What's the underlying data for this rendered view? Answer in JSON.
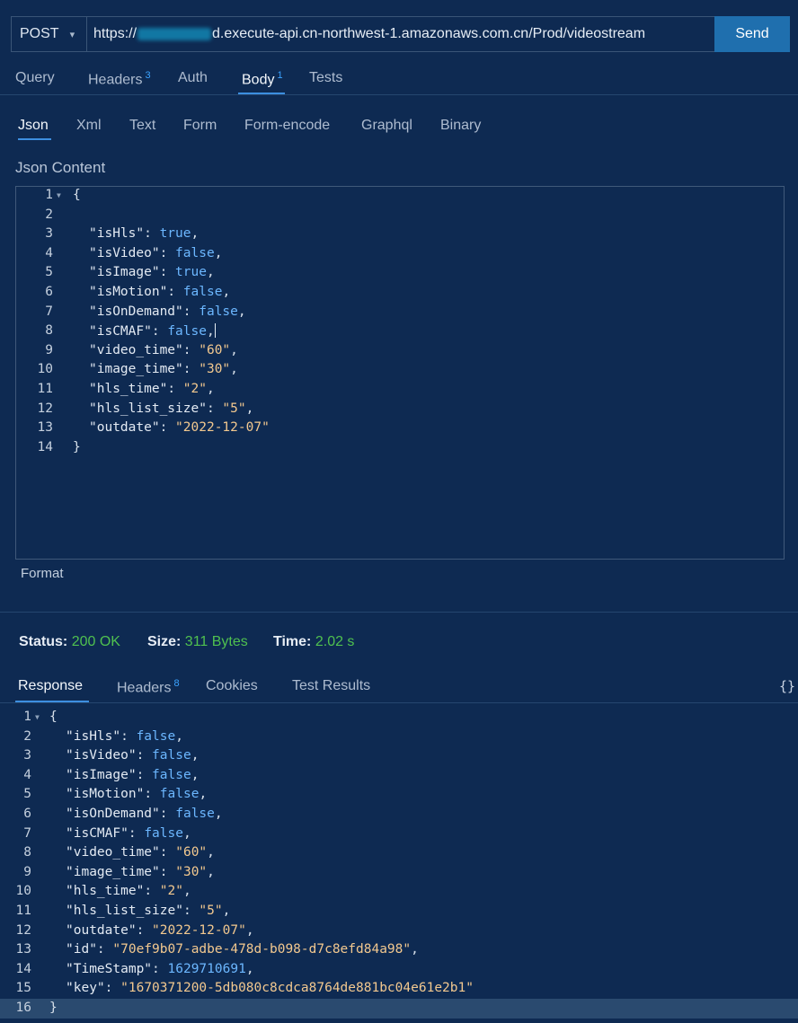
{
  "request": {
    "method": "POST",
    "url_prefix": "https://",
    "url_suffix": "d.execute-api.cn-northwest-1.amazonaws.com.cn/Prod/videostream",
    "send_label": "Send"
  },
  "tabs": [
    {
      "label": "Query",
      "badge": ""
    },
    {
      "label": "Headers",
      "badge": "3"
    },
    {
      "label": "Auth",
      "badge": ""
    },
    {
      "label": "Body",
      "badge": "1"
    },
    {
      "label": "Tests",
      "badge": ""
    }
  ],
  "body_tabs": [
    "Json",
    "Xml",
    "Text",
    "Form",
    "Form-encode",
    "Graphql",
    "Binary"
  ],
  "json_content_label": "Json Content",
  "request_lines": [
    [
      {
        "t": "p",
        "v": "{"
      }
    ],
    [],
    [
      {
        "t": "k",
        "v": "\"isHls\""
      },
      {
        "t": "p",
        "v": ": "
      },
      {
        "t": "b",
        "v": "true"
      },
      {
        "t": "p",
        "v": ","
      }
    ],
    [
      {
        "t": "k",
        "v": "\"isVideo\""
      },
      {
        "t": "p",
        "v": ": "
      },
      {
        "t": "b",
        "v": "false"
      },
      {
        "t": "p",
        "v": ","
      }
    ],
    [
      {
        "t": "k",
        "v": "\"isImage\""
      },
      {
        "t": "p",
        "v": ": "
      },
      {
        "t": "b",
        "v": "true"
      },
      {
        "t": "p",
        "v": ","
      }
    ],
    [
      {
        "t": "k",
        "v": "\"isMotion\""
      },
      {
        "t": "p",
        "v": ": "
      },
      {
        "t": "b",
        "v": "false"
      },
      {
        "t": "p",
        "v": ","
      }
    ],
    [
      {
        "t": "k",
        "v": "\"isOnDemand\""
      },
      {
        "t": "p",
        "v": ": "
      },
      {
        "t": "b",
        "v": "false"
      },
      {
        "t": "p",
        "v": ","
      }
    ],
    [
      {
        "t": "k",
        "v": "\"isCMAF\""
      },
      {
        "t": "p",
        "v": ": "
      },
      {
        "t": "b",
        "v": "false"
      },
      {
        "t": "p",
        "v": ","
      }
    ],
    [
      {
        "t": "k",
        "v": "\"video_time\""
      },
      {
        "t": "p",
        "v": ": "
      },
      {
        "t": "s",
        "v": "\"60\""
      },
      {
        "t": "p",
        "v": ","
      }
    ],
    [
      {
        "t": "k",
        "v": "\"image_time\""
      },
      {
        "t": "p",
        "v": ": "
      },
      {
        "t": "s",
        "v": "\"30\""
      },
      {
        "t": "p",
        "v": ","
      }
    ],
    [
      {
        "t": "k",
        "v": "\"hls_time\""
      },
      {
        "t": "p",
        "v": ": "
      },
      {
        "t": "s",
        "v": "\"2\""
      },
      {
        "t": "p",
        "v": ","
      }
    ],
    [
      {
        "t": "k",
        "v": "\"hls_list_size\""
      },
      {
        "t": "p",
        "v": ": "
      },
      {
        "t": "s",
        "v": "\"5\""
      },
      {
        "t": "p",
        "v": ","
      }
    ],
    [
      {
        "t": "k",
        "v": "\"outdate\""
      },
      {
        "t": "p",
        "v": ": "
      },
      {
        "t": "s",
        "v": "\"2022-12-07\""
      }
    ],
    [
      {
        "t": "p",
        "v": "}"
      }
    ]
  ],
  "format_label": "Format",
  "status": {
    "status_label": "Status:",
    "status_value": "200 OK",
    "size_label": "Size:",
    "size_value": "311 Bytes",
    "time_label": "Time:",
    "time_value": "2.02 s"
  },
  "response_tabs": [
    {
      "label": "Response",
      "badge": ""
    },
    {
      "label": "Headers",
      "badge": "8"
    },
    {
      "label": "Cookies",
      "badge": ""
    },
    {
      "label": "Test Results",
      "badge": ""
    }
  ],
  "braces_icon_label": "{}",
  "response_lines": [
    [
      {
        "t": "p",
        "v": "{"
      }
    ],
    [
      {
        "t": "k",
        "v": "\"isHls\""
      },
      {
        "t": "p",
        "v": ": "
      },
      {
        "t": "b",
        "v": "false"
      },
      {
        "t": "p",
        "v": ","
      }
    ],
    [
      {
        "t": "k",
        "v": "\"isVideo\""
      },
      {
        "t": "p",
        "v": ": "
      },
      {
        "t": "b",
        "v": "false"
      },
      {
        "t": "p",
        "v": ","
      }
    ],
    [
      {
        "t": "k",
        "v": "\"isImage\""
      },
      {
        "t": "p",
        "v": ": "
      },
      {
        "t": "b",
        "v": "false"
      },
      {
        "t": "p",
        "v": ","
      }
    ],
    [
      {
        "t": "k",
        "v": "\"isMotion\""
      },
      {
        "t": "p",
        "v": ": "
      },
      {
        "t": "b",
        "v": "false"
      },
      {
        "t": "p",
        "v": ","
      }
    ],
    [
      {
        "t": "k",
        "v": "\"isOnDemand\""
      },
      {
        "t": "p",
        "v": ": "
      },
      {
        "t": "b",
        "v": "false"
      },
      {
        "t": "p",
        "v": ","
      }
    ],
    [
      {
        "t": "k",
        "v": "\"isCMAF\""
      },
      {
        "t": "p",
        "v": ": "
      },
      {
        "t": "b",
        "v": "false"
      },
      {
        "t": "p",
        "v": ","
      }
    ],
    [
      {
        "t": "k",
        "v": "\"video_time\""
      },
      {
        "t": "p",
        "v": ": "
      },
      {
        "t": "s",
        "v": "\"60\""
      },
      {
        "t": "p",
        "v": ","
      }
    ],
    [
      {
        "t": "k",
        "v": "\"image_time\""
      },
      {
        "t": "p",
        "v": ": "
      },
      {
        "t": "s",
        "v": "\"30\""
      },
      {
        "t": "p",
        "v": ","
      }
    ],
    [
      {
        "t": "k",
        "v": "\"hls_time\""
      },
      {
        "t": "p",
        "v": ": "
      },
      {
        "t": "s",
        "v": "\"2\""
      },
      {
        "t": "p",
        "v": ","
      }
    ],
    [
      {
        "t": "k",
        "v": "\"hls_list_size\""
      },
      {
        "t": "p",
        "v": ": "
      },
      {
        "t": "s",
        "v": "\"5\""
      },
      {
        "t": "p",
        "v": ","
      }
    ],
    [
      {
        "t": "k",
        "v": "\"outdate\""
      },
      {
        "t": "p",
        "v": ": "
      },
      {
        "t": "s",
        "v": "\"2022-12-07\""
      },
      {
        "t": "p",
        "v": ","
      }
    ],
    [
      {
        "t": "k",
        "v": "\"id\""
      },
      {
        "t": "p",
        "v": ": "
      },
      {
        "t": "s",
        "v": "\"70ef9b07-adbe-478d-b098-d7c8efd84a98\""
      },
      {
        "t": "p",
        "v": ","
      }
    ],
    [
      {
        "t": "k",
        "v": "\"TimeStamp\""
      },
      {
        "t": "p",
        "v": ": "
      },
      {
        "t": "n",
        "v": "1629710691"
      },
      {
        "t": "p",
        "v": ","
      }
    ],
    [
      {
        "t": "k",
        "v": "\"key\""
      },
      {
        "t": "p",
        "v": ": "
      },
      {
        "t": "s",
        "v": "\"1670371200-5db080c8cdca8764de881bc04e61e2b1\""
      }
    ],
    [
      {
        "t": "p",
        "v": "}"
      }
    ]
  ]
}
